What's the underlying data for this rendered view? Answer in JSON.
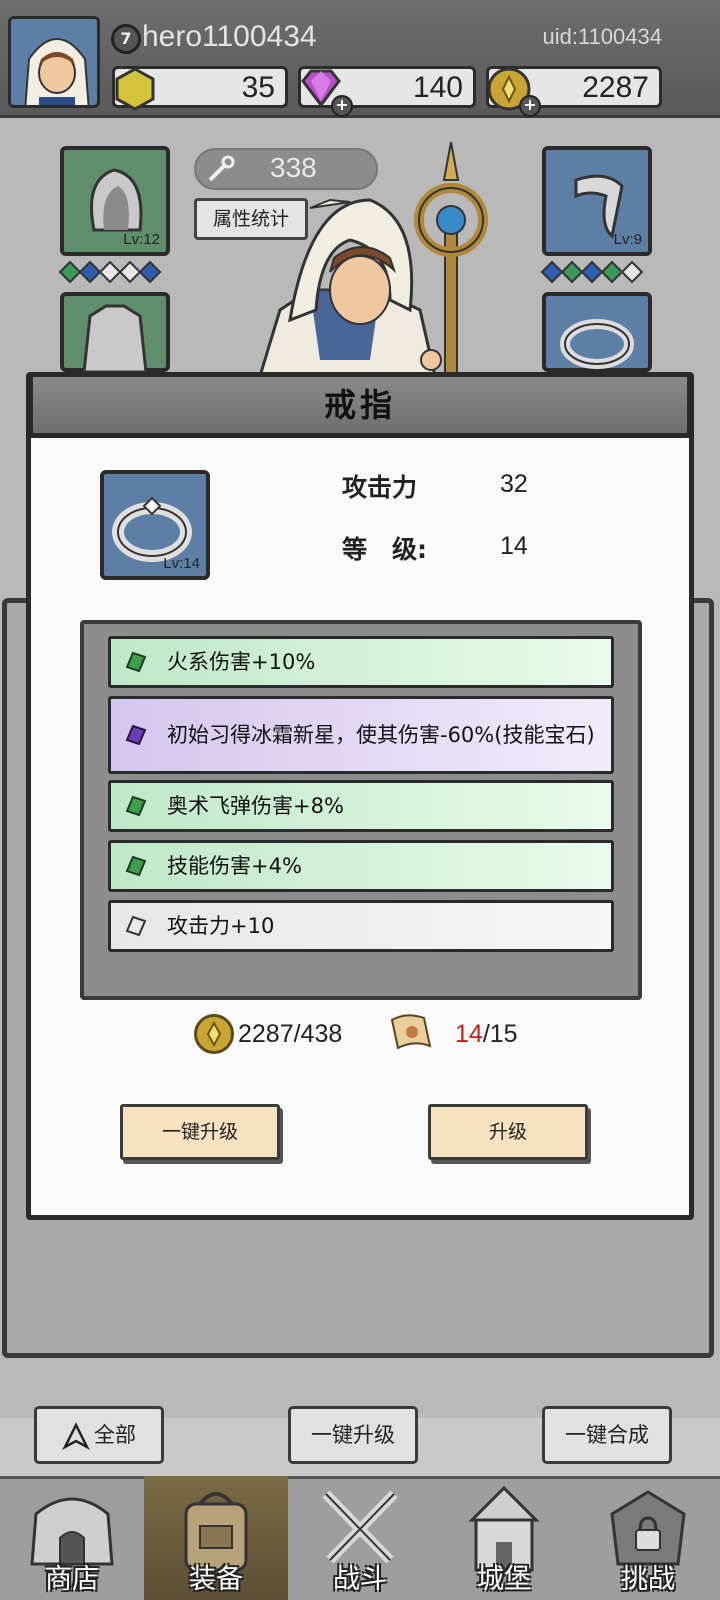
{
  "header": {
    "player_level": "7",
    "player_name": "hero1100434",
    "uid": "uid:1100434",
    "resources": [
      {
        "name": "hex-coin",
        "value": "35"
      },
      {
        "name": "gem",
        "value": "140"
      },
      {
        "name": "gold",
        "value": "2287"
      }
    ]
  },
  "equipment": {
    "power": "338",
    "stats_button": "属性统计",
    "left_top_slot_lv": "Lv:12",
    "right_top_slot_lv": "Lv:9"
  },
  "modal": {
    "title": "戒指",
    "item_level_badge": "Lv:14",
    "stats": [
      {
        "label": "攻击力",
        "value": "32"
      },
      {
        "label": "等　级:",
        "value": "14"
      }
    ],
    "attributes": [
      {
        "text": "火系伤害+10%",
        "tier": "green"
      },
      {
        "text": "初始习得冰霜新星，使其伤害-60%(技能宝石)",
        "tier": "purple"
      },
      {
        "text": "奥术飞弹伤害+8%",
        "tier": "green"
      },
      {
        "text": "技能伤害+4%",
        "tier": "green"
      },
      {
        "text": "攻击力+10",
        "tier": "white"
      }
    ],
    "gold_cost": "2287/438",
    "scroll_have": "14",
    "scroll_need": "/15",
    "btn_one_key_upgrade": "一键升级",
    "btn_upgrade": "升级"
  },
  "bottom_actions": {
    "all": "全部",
    "one_key_upgrade": "一键升级",
    "one_key_merge": "一键合成"
  },
  "nav": [
    {
      "label": "商店",
      "icon": "shop-icon"
    },
    {
      "label": "装备",
      "icon": "backpack-icon",
      "active": true
    },
    {
      "label": "战斗",
      "icon": "crossed-swords-icon"
    },
    {
      "label": "城堡",
      "icon": "castle-icon"
    },
    {
      "label": "挑战",
      "icon": "challenge-icon"
    }
  ],
  "colors": {
    "scroll_have_color": "#d11a1a",
    "green_attr": "#bfe8c8",
    "purple_attr": "#d4c6ee"
  }
}
